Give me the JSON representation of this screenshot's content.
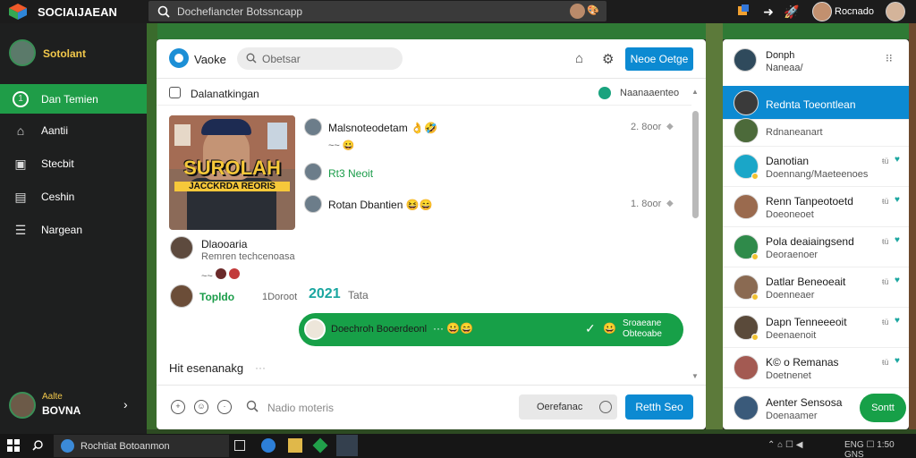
{
  "topbar": {
    "app_name": "SOCIAIJAEAN",
    "search_text": "Dochefiancter Botssncapp",
    "search_emoji": "🎨",
    "user_name": "Rocnado"
  },
  "sidebar": {
    "profile_name": "Sotolant",
    "items": [
      {
        "label": "Dan Temien",
        "icon": "1",
        "active": true
      },
      {
        "label": "Aantii",
        "icon": "⌂"
      },
      {
        "label": "Stecbit",
        "icon": "▣"
      },
      {
        "label": "Ceshin",
        "icon": "▤"
      },
      {
        "label": "Nargean",
        "icon": "☰"
      }
    ],
    "bottom_label": "Aalte",
    "bottom_name": "BOVNA"
  },
  "chat": {
    "title": "Vaoke",
    "search_placeholder": "Obetsar",
    "header_button": "Neoe Oetge",
    "sub_title": "Dalanatkingan",
    "sub_right": "Naanaaenteo",
    "post_image_title": "SUROLAH",
    "post_image_caption": "JACCKRDA REORIS",
    "messages": [
      {
        "text": "Malsnoteodetam",
        "emoji": "👌🤣",
        "sub": "~~",
        "sub_emoji": "😀",
        "time": "2. 8oor"
      },
      {
        "text": "Rt3 Neoit",
        "emoji": "",
        "sub": "",
        "sub_emoji": "",
        "time": ""
      },
      {
        "text": "Rotan Dbantien",
        "emoji": "😆😄",
        "sub": "",
        "sub_emoji": "",
        "time": "1. 8oor"
      }
    ],
    "user_post": {
      "name": "Dlaooaria",
      "sub": "Remren techcenoasa",
      "reactions": "~~"
    },
    "user_post2": {
      "name": "Topldo",
      "time": "1Doroot"
    },
    "count": "2021",
    "count_label": "Tata",
    "bubble": {
      "text": "Doechroh Booerdeonl",
      "dots": "···",
      "emoji": "😀😄",
      "r1": "Sroaeane",
      "r2": "Obteoabe",
      "emoji2": "😀"
    },
    "typing": "Hit esenanakg",
    "typing_dots": "···",
    "composer_placeholder": "Nadio moteris",
    "composer_field": "Oerefanac",
    "send_label": "Retth Seo"
  },
  "right_panel": {
    "head_name1": "Donph",
    "head_name2": "Naneaa/",
    "rows": [
      {
        "name": "Rednta Toeontlean",
        "sub": "",
        "active": true
      },
      {
        "name": "",
        "sub": "Rdnaneanart",
        "active": false
      },
      {
        "name": "Danotian",
        "sub": "Doennang/Maeteenoes",
        "active": false
      },
      {
        "name": "Renn Tanpeotoetd",
        "sub": "Doeoneoet",
        "active": false
      },
      {
        "name": "Pola deaiaingsend",
        "sub": "Deoraenoer",
        "active": false
      },
      {
        "name": "Datlar Beneoeait",
        "sub": "Doenneaer",
        "active": false
      },
      {
        "name": "Dapn Tenneeeoit",
        "sub": "Deenaenoit",
        "active": false
      },
      {
        "name": "K© o Remanas",
        "sub": "Doetnenet",
        "active": false
      },
      {
        "name": "Aenter Sensosa",
        "sub": "Doenaamer",
        "active": false
      }
    ],
    "row_status": "ŧü",
    "fab_label": "Sontt"
  },
  "taskbar": {
    "app_label": "Rochtiat Botoanmon",
    "tray_text": "ENG ☐ 1:50 GNS"
  }
}
